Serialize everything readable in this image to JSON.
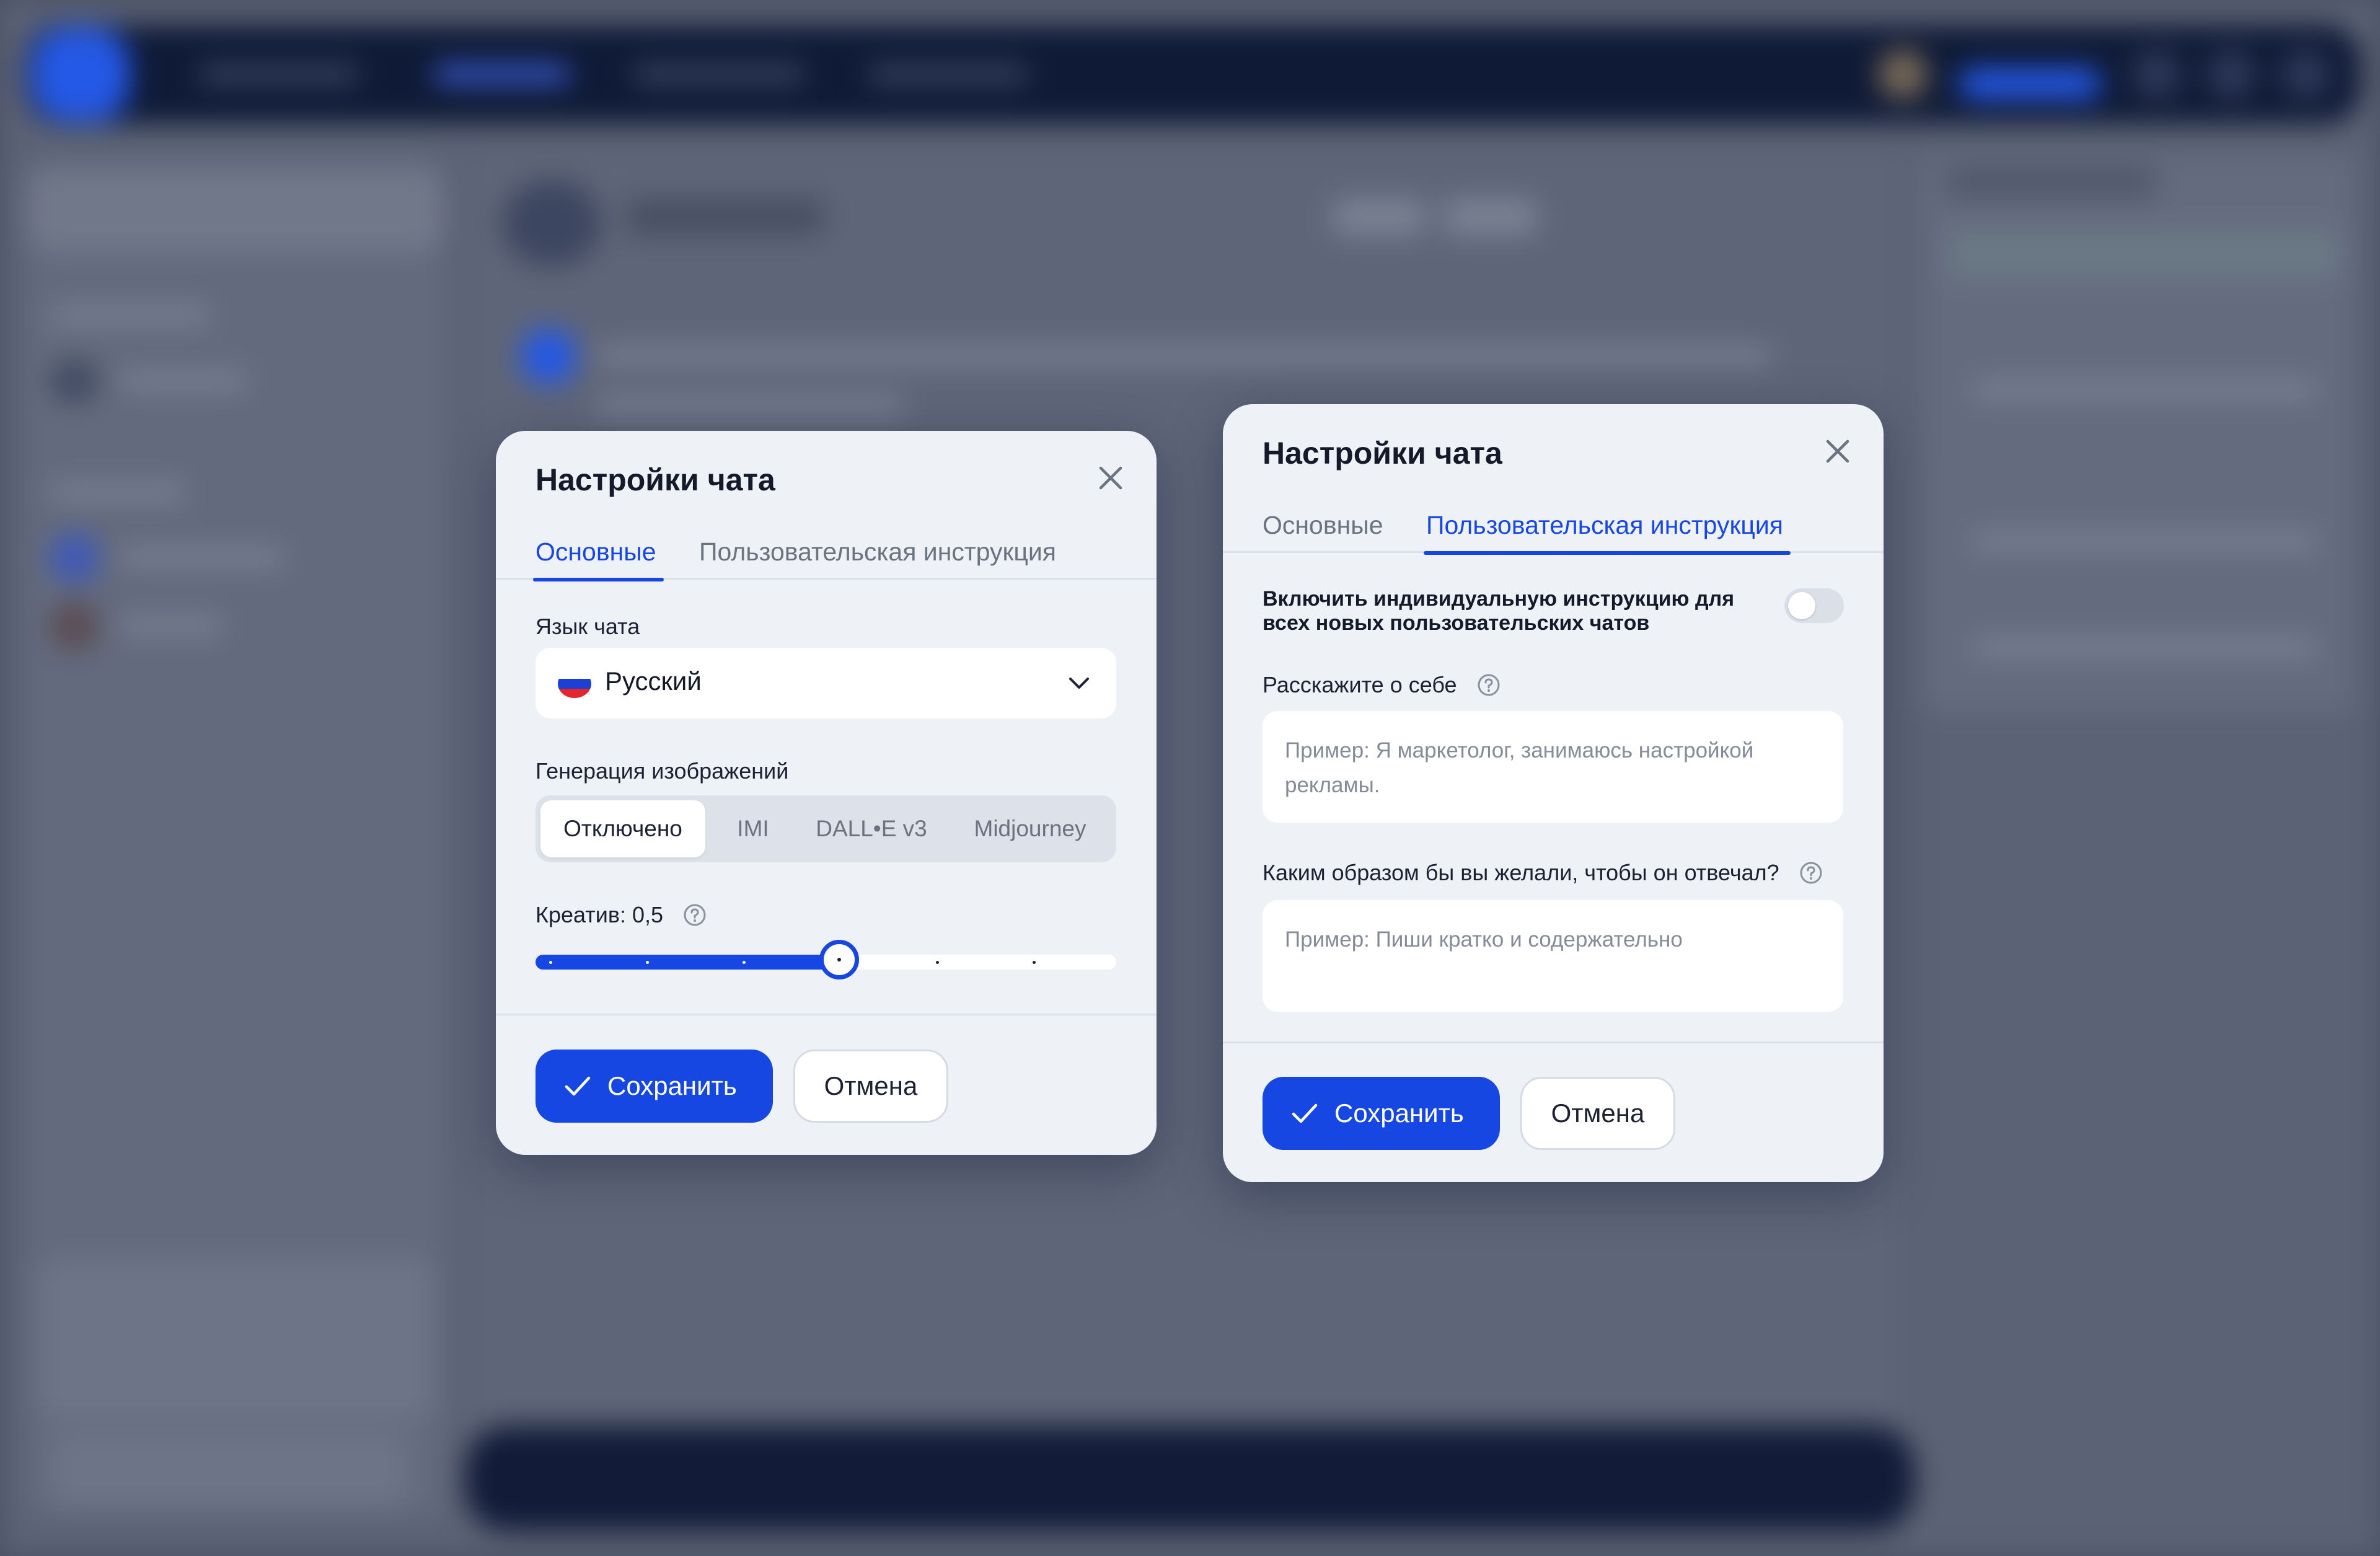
{
  "dialog_general": {
    "title": "Настройки чата",
    "tabs": [
      "Основные",
      "Пользовательская инструкция"
    ],
    "language_label": "Язык чата",
    "language_value": "Русский",
    "image_gen_label": "Генерация изображений",
    "image_gen_options": [
      "Отключено",
      "IMI",
      "DALL•E v3",
      "Midjourney"
    ],
    "image_gen_selected": "Отключено",
    "creativity_label": "Креатив: 0,5",
    "creativity_value": 0.5,
    "save_label": "Сохранить",
    "cancel_label": "Отмена"
  },
  "dialog_instructions": {
    "title": "Настройки чата",
    "tabs": [
      "Основные",
      "Пользовательская инструкция"
    ],
    "toggle_label": "Включить индивидуальную инструкцию для всех новых пользовательских чатов",
    "toggle_on": false,
    "about_label": "Расскажите о себе",
    "about_placeholder": "Пример: Я маркетолог, занимаюсь настройкой рекламы.",
    "response_label": "Каким образом бы вы желали, чтобы он отвечал?",
    "response_placeholder": "Пример: Пиши кратко и содержательно",
    "save_label": "Сохранить",
    "cancel_label": "Отмена"
  },
  "colors": {
    "accent": "#1747e3",
    "dialog_bg": "#eef1f5",
    "overlay": "#4a5164"
  },
  "icons": {
    "close": "close-icon",
    "help": "help-icon",
    "chevron": "chevron-down-icon",
    "check": "check-icon",
    "flag": "russia-flag-icon"
  }
}
